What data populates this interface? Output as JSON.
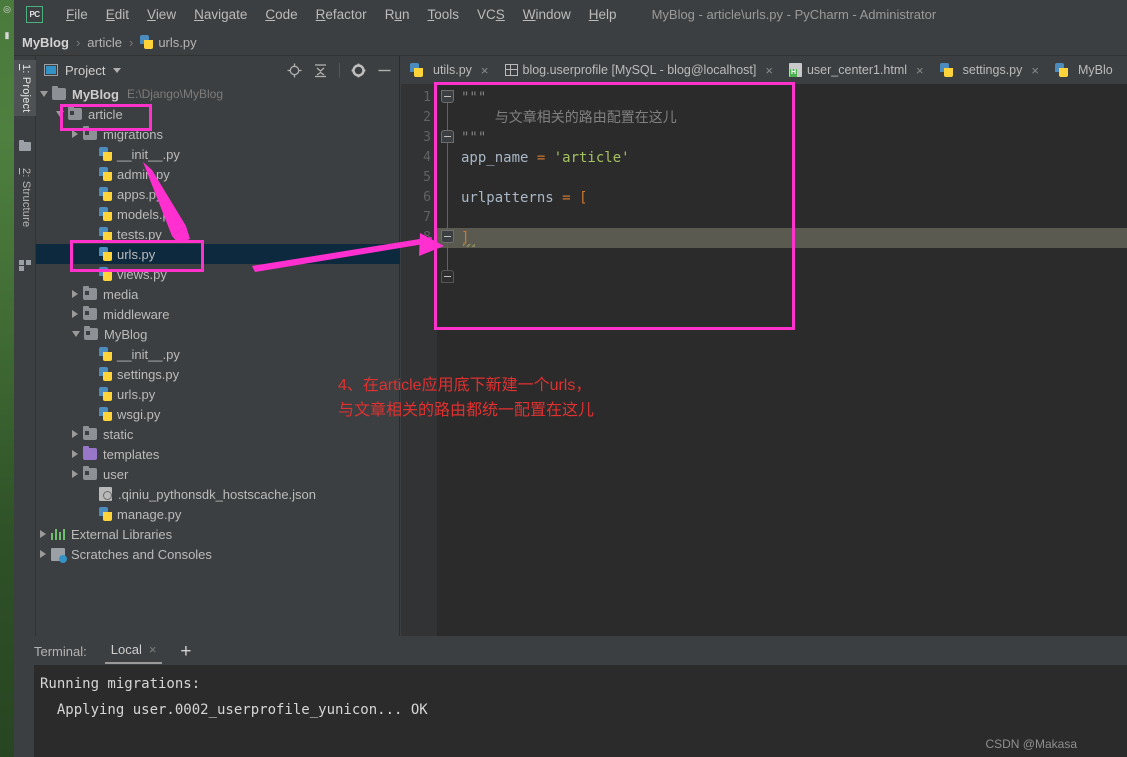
{
  "window": {
    "title": "MyBlog - article\\urls.py - PyCharm - Administrator",
    "logo": "PC"
  },
  "menu": {
    "items": [
      {
        "label": "File"
      },
      {
        "label": "Edit"
      },
      {
        "label": "View"
      },
      {
        "label": "Navigate"
      },
      {
        "label": "Code"
      },
      {
        "label": "Refactor"
      },
      {
        "label": "Run"
      },
      {
        "label": "Tools"
      },
      {
        "label": "VCS"
      },
      {
        "label": "Window"
      },
      {
        "label": "Help"
      }
    ]
  },
  "breadcrumb": {
    "items": [
      "MyBlog",
      "article",
      "urls.py"
    ],
    "separator": "›"
  },
  "toolwindow_bar": {
    "tabs": [
      {
        "label": "1: Project",
        "active": true
      },
      {
        "label": "2: Structure",
        "active": false
      }
    ]
  },
  "project_panel": {
    "title": "Project",
    "tools": [
      "locate-icon",
      "collapse-all-icon",
      "gear-icon",
      "minimize-icon"
    ],
    "tree": [
      {
        "indent": 0,
        "arrow": "down",
        "icon": "folder",
        "label": "MyBlog",
        "bold": true,
        "path": "E:\\Django\\MyBlog"
      },
      {
        "indent": 1,
        "arrow": "down",
        "icon": "folder-module",
        "label": "article"
      },
      {
        "indent": 2,
        "arrow": "right",
        "icon": "folder-module",
        "label": "migrations"
      },
      {
        "indent": 3,
        "arrow": "none",
        "icon": "python",
        "label": "__init__.py"
      },
      {
        "indent": 3,
        "arrow": "none",
        "icon": "python",
        "label": "admin.py"
      },
      {
        "indent": 3,
        "arrow": "none",
        "icon": "python",
        "label": "apps.py"
      },
      {
        "indent": 3,
        "arrow": "none",
        "icon": "python",
        "label": "models.py"
      },
      {
        "indent": 3,
        "arrow": "none",
        "icon": "python",
        "label": "tests.py"
      },
      {
        "indent": 3,
        "arrow": "none",
        "icon": "python",
        "label": "urls.py",
        "selected": true
      },
      {
        "indent": 3,
        "arrow": "none",
        "icon": "python",
        "label": "views.py"
      },
      {
        "indent": 2,
        "arrow": "right",
        "icon": "folder-module",
        "label": "media"
      },
      {
        "indent": 2,
        "arrow": "right",
        "icon": "folder-module",
        "label": "middleware"
      },
      {
        "indent": 2,
        "arrow": "down",
        "icon": "folder-module",
        "label": "MyBlog"
      },
      {
        "indent": 3,
        "arrow": "none",
        "icon": "python",
        "label": "__init__.py"
      },
      {
        "indent": 3,
        "arrow": "none",
        "icon": "python",
        "label": "settings.py"
      },
      {
        "indent": 3,
        "arrow": "none",
        "icon": "python",
        "label": "urls.py"
      },
      {
        "indent": 3,
        "arrow": "none",
        "icon": "python",
        "label": "wsgi.py"
      },
      {
        "indent": 2,
        "arrow": "right",
        "icon": "folder-module",
        "label": "static"
      },
      {
        "indent": 2,
        "arrow": "right",
        "icon": "folder-purple",
        "label": "templates"
      },
      {
        "indent": 2,
        "arrow": "right",
        "icon": "folder-module",
        "label": "user"
      },
      {
        "indent": 3,
        "arrow": "none",
        "icon": "json",
        "label": ".qiniu_pythonsdk_hostscache.json"
      },
      {
        "indent": 3,
        "arrow": "none",
        "icon": "python",
        "label": "manage.py"
      },
      {
        "indent": 0,
        "arrow": "right",
        "icon": "libraries",
        "label": "External Libraries"
      },
      {
        "indent": 0,
        "arrow": "right",
        "icon": "scratches",
        "label": "Scratches and Consoles"
      }
    ]
  },
  "editor": {
    "tabs": [
      {
        "label": "utils.py",
        "icon": "python-icon",
        "close": "×"
      },
      {
        "label": "blog.userprofile [MySQL - blog@localhost]",
        "icon": "database-icon",
        "close": "×"
      },
      {
        "label": "user_center1.html",
        "icon": "html-icon",
        "close": "×"
      },
      {
        "label": "settings.py",
        "icon": "python-icon",
        "close": "×"
      },
      {
        "label": "MyBlo",
        "icon": "python-icon",
        "close": ""
      }
    ],
    "line_numbers": [
      "1",
      "2",
      "3",
      "4",
      "5",
      "6",
      "7",
      "8"
    ],
    "caret_line": 8,
    "lines": [
      {
        "n": 1,
        "tokens": [
          {
            "t": "\"\"\"",
            "c": "cmt"
          }
        ]
      },
      {
        "n": 2,
        "tokens": [
          {
            "t": "    与文章相关的路由配置在这儿",
            "c": "cmt"
          }
        ]
      },
      {
        "n": 3,
        "tokens": [
          {
            "t": "\"\"\"",
            "c": "cmt"
          }
        ]
      },
      {
        "n": 4,
        "tokens": [
          {
            "t": "app_name ",
            "c": "var"
          },
          {
            "t": "= ",
            "c": "op"
          },
          {
            "t": "'article'",
            "c": "str"
          }
        ]
      },
      {
        "n": 5,
        "tokens": []
      },
      {
        "n": 6,
        "tokens": [
          {
            "t": "urlpatterns ",
            "c": "var"
          },
          {
            "t": "= ",
            "c": "op"
          },
          {
            "t": "[",
            "c": "brk"
          }
        ]
      },
      {
        "n": 7,
        "tokens": []
      },
      {
        "n": 8,
        "tokens": [
          {
            "t": "]",
            "c": "brk"
          }
        ]
      }
    ]
  },
  "annotations": {
    "note_line1": "4、在article应用底下新建一个urls，",
    "note_line2": "与文章相关的路由都统一配置在这儿",
    "highlight_color": "#ff33cc",
    "note_color": "#e03030"
  },
  "terminal": {
    "label": "Terminal:",
    "tab": "Local",
    "tab_close": "×",
    "add": "+",
    "output": [
      "Running migrations:",
      "  Applying user.0002_userprofile_yunicon... OK"
    ]
  },
  "watermark": "CSDN @Makasa"
}
